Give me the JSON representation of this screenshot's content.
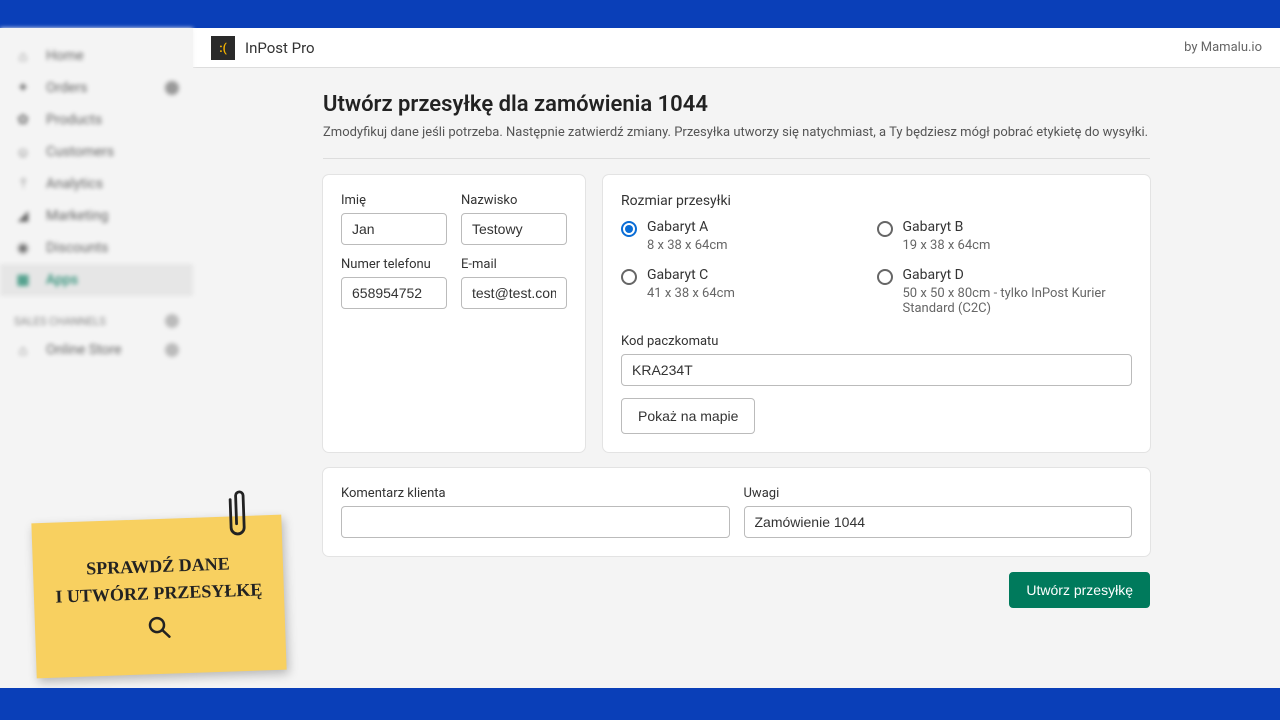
{
  "appbar": {
    "title": "InPost Pro",
    "by": "by Mamalu.io"
  },
  "sidebar": {
    "items": [
      {
        "label": "Home"
      },
      {
        "label": "Orders"
      },
      {
        "label": "Products"
      },
      {
        "label": "Customers"
      },
      {
        "label": "Analytics"
      },
      {
        "label": "Marketing"
      },
      {
        "label": "Discounts"
      },
      {
        "label": "Apps"
      }
    ],
    "section": "SALES CHANNELS",
    "store": "Online Store"
  },
  "page": {
    "title": "Utwórz przesyłkę dla zamówienia 1044",
    "subtitle": "Zmodyfikuj dane jeśli potrzeba. Następnie zatwierdź zmiany. Przesyłka utworzy się natychmiast, a Ty będziesz mógł pobrać etykietę do wysyłki."
  },
  "form": {
    "firstname_label": "Imię",
    "firstname": "Jan",
    "lastname_label": "Nazwisko",
    "lastname": "Testowy",
    "phone_label": "Numer telefonu",
    "phone": "658954752",
    "email_label": "E-mail",
    "email": "test@test.com",
    "size_label": "Rozmiar przesyłki",
    "sizes": [
      {
        "label": "Gabaryt A",
        "sub": "8 x 38 x 64cm"
      },
      {
        "label": "Gabaryt B",
        "sub": "19 x 38 x 64cm"
      },
      {
        "label": "Gabaryt C",
        "sub": "41 x 38 x 64cm"
      },
      {
        "label": "Gabaryt D",
        "sub": "50 x 50 x 80cm - tylko InPost Kurier Standard (C2C)"
      }
    ],
    "locker_label": "Kod paczkomatu",
    "locker": "KRA234T",
    "map_btn": "Pokaż na mapie",
    "comment_label": "Komentarz klienta",
    "comment": "",
    "notes_label": "Uwagi",
    "notes": "Zamówienie 1044",
    "submit": "Utwórz przesyłkę"
  },
  "sticky": {
    "line1": "Sprawdź dane",
    "line2": "i utwórz przesyłkę"
  }
}
